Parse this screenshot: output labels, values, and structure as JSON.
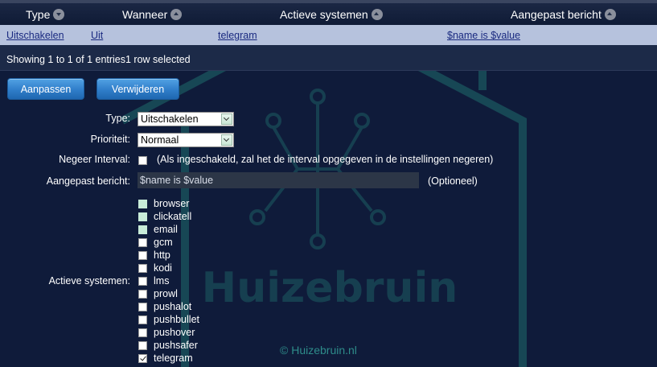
{
  "table": {
    "headers": [
      "Type",
      "Wanneer",
      "Actieve systemen",
      "Aangepast bericht"
    ],
    "row": [
      "Uitschakelen",
      "Uit",
      "telegram",
      "$name is $value"
    ]
  },
  "info": "Showing 1 to 1 of 1 entries1 row selected",
  "buttons": {
    "edit": "Aanpassen",
    "delete": "Verwijderen"
  },
  "form": {
    "type_label": "Type:",
    "type_value": "Uitschakelen",
    "priority_label": "Prioriteit:",
    "priority_value": "Normaal",
    "ignore_label": "Negeer Interval:",
    "ignore_hint": "(Als ingeschakeld, zal het de interval opgegeven in de instellingen negeren)",
    "message_label": "Aangepast bericht:",
    "message_value": "$name is $value",
    "optional": "(Optioneel)",
    "systems_label": "Actieve systemen:",
    "systems": [
      {
        "name": "browser",
        "checked": false,
        "style": "light"
      },
      {
        "name": "clickatell",
        "checked": false,
        "style": "light"
      },
      {
        "name": "email",
        "checked": false,
        "style": "light"
      },
      {
        "name": "gcm",
        "checked": false,
        "style": "white"
      },
      {
        "name": "http",
        "checked": false,
        "style": "white"
      },
      {
        "name": "kodi",
        "checked": false,
        "style": "white"
      },
      {
        "name": "lms",
        "checked": false,
        "style": "white"
      },
      {
        "name": "prowl",
        "checked": false,
        "style": "white"
      },
      {
        "name": "pushalot",
        "checked": false,
        "style": "white"
      },
      {
        "name": "pushbullet",
        "checked": false,
        "style": "white"
      },
      {
        "name": "pushover",
        "checked": false,
        "style": "white"
      },
      {
        "name": "pushsafer",
        "checked": false,
        "style": "white"
      },
      {
        "name": "telegram",
        "checked": true,
        "style": "white"
      }
    ]
  },
  "watermark": {
    "brand": "Huizebruin",
    "copyright": "© Huizebruin.nl"
  },
  "colors": {
    "background": "#0f1b3a",
    "selected_row": "#b6c2dd",
    "button": "#2f7dc9",
    "watermark": "#2e8c8a"
  }
}
